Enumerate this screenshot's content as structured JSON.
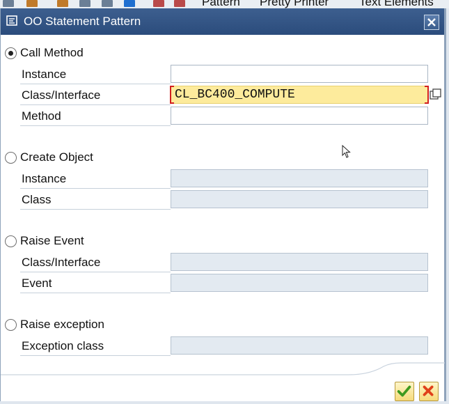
{
  "background_toolbar": {
    "items": [
      "Pattern",
      "Pretty Printer",
      "Text Elements"
    ]
  },
  "dialog": {
    "title": "OO Statement Pattern",
    "title_icon": "pattern-icon",
    "close_icon": "close-icon"
  },
  "groups": [
    {
      "label": "Call Method",
      "selected": true,
      "fields": [
        {
          "label": "Instance",
          "value": "",
          "enabled": true
        },
        {
          "label": "Class/Interface",
          "value": "CL_BC400_COMPUTE",
          "enabled": true,
          "focused": true,
          "has_f4_help": true
        },
        {
          "label": "Method",
          "value": "",
          "enabled": true
        }
      ]
    },
    {
      "label": "Create Object",
      "selected": false,
      "fields": [
        {
          "label": "Instance",
          "value": "",
          "enabled": false
        },
        {
          "label": "Class",
          "value": "",
          "enabled": false
        }
      ]
    },
    {
      "label": "Raise Event",
      "selected": false,
      "fields": [
        {
          "label": "Class/Interface",
          "value": "",
          "enabled": false
        },
        {
          "label": "Event",
          "value": "",
          "enabled": false
        }
      ]
    },
    {
      "label": "Raise exception",
      "selected": false,
      "fields": [
        {
          "label": "Exception class",
          "value": "",
          "enabled": false
        }
      ]
    }
  ],
  "footer": {
    "confirm_icon": "checkmark-icon",
    "cancel_icon": "cancel-x-icon"
  },
  "colors": {
    "title_bar": "#2b4c7c",
    "focused_field": "#fdeb9c",
    "disabled_field": "#e3eaf1",
    "confirm": "#3f9a1f",
    "cancel": "#e0401a"
  }
}
